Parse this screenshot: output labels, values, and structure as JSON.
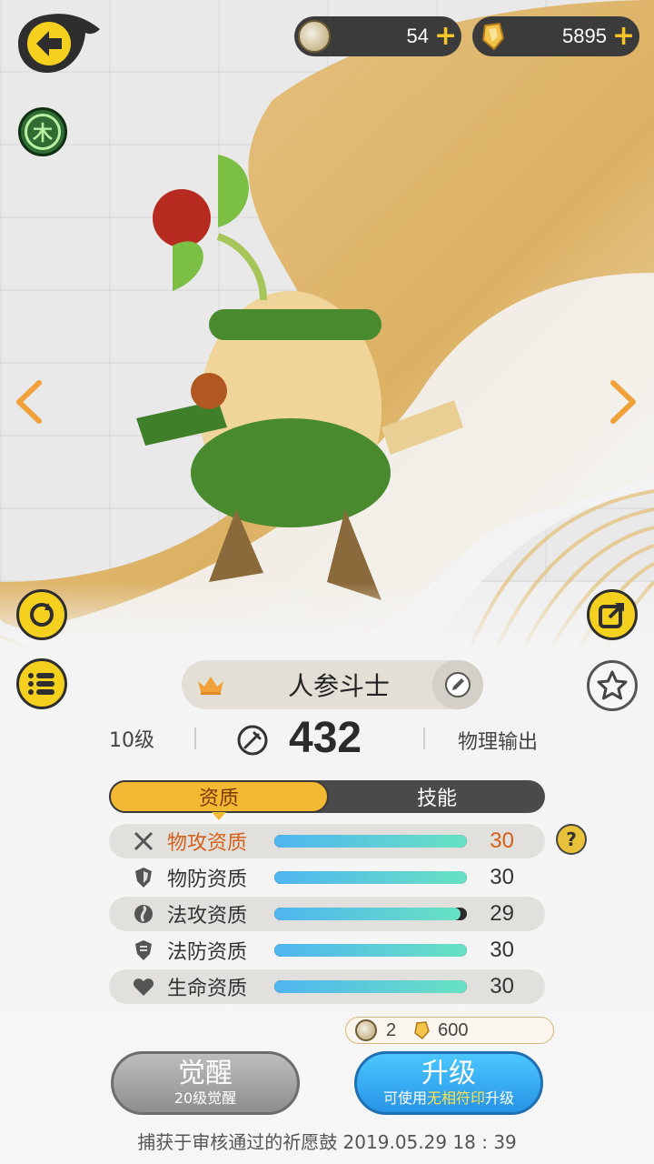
{
  "currencies": {
    "coins": {
      "value": "54",
      "plus": "+",
      "icon": "coin-icon"
    },
    "gems": {
      "value": "5895",
      "plus": "+",
      "icon": "gem-icon"
    }
  },
  "element": {
    "label": "木"
  },
  "pet": {
    "name": "人参斗士",
    "level": "10级",
    "power": "432",
    "damage_type": "物理输出"
  },
  "tabs": [
    {
      "label": "资质",
      "active": true
    },
    {
      "label": "技能",
      "active": false
    }
  ],
  "attributes": [
    {
      "label": "物攻资质",
      "value": "30",
      "fraction": 1.0,
      "icon": "swords-icon"
    },
    {
      "label": "物防资质",
      "value": "30",
      "fraction": 1.0,
      "icon": "shield-icon"
    },
    {
      "label": "法攻资质",
      "value": "29",
      "fraction": 0.967,
      "icon": "magic-orb-icon"
    },
    {
      "label": "法防资质",
      "value": "30",
      "fraction": 1.0,
      "icon": "magic-shield-icon"
    },
    {
      "label": "生命资质",
      "value": "30",
      "fraction": 1.0,
      "icon": "heart-icon"
    }
  ],
  "cost": {
    "coins": "2",
    "gems": "600"
  },
  "buttons": {
    "awaken": {
      "label": "觉醒",
      "sub": "20级觉醒"
    },
    "upgrade": {
      "label": "升级",
      "sub_prefix": "可使用",
      "sub_highlight": "无相符印",
      "sub_suffix": "升级"
    }
  },
  "caught_text": "捕获于审核通过的祈愿鼓 2019.05.29   18 : 39",
  "colors": {
    "accent": "#f3b933",
    "highlight": "#d4611a",
    "upgrade": "#2f9cf0"
  }
}
